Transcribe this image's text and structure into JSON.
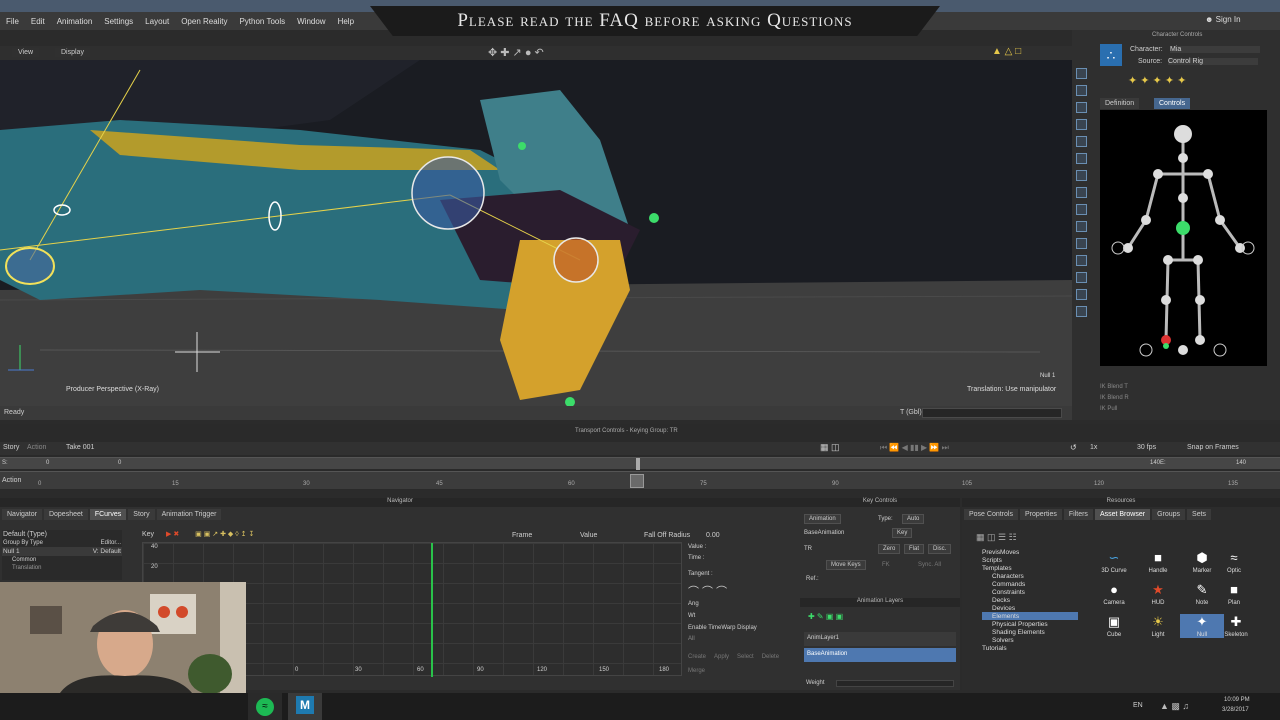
{
  "menu": [
    "File",
    "Edit",
    "Animation",
    "Settings",
    "Layout",
    "Open Reality",
    "Python Tools",
    "Window",
    "Help"
  ],
  "banner_text": "Please read the FAQ before asking Questions",
  "sign_in": "Sign In",
  "viewport": {
    "tabs": [
      "View",
      "Display"
    ],
    "camera_label": "Producer Perspective (X-Ray)",
    "object_label": "Null 1",
    "hint": "Translation: Use manipulator",
    "status": "Ready",
    "gbl": "T (Gbl)"
  },
  "char_controls": {
    "title": "Character Controls",
    "character_label": "Character:",
    "character_value": "Mia",
    "source_label": "Source:",
    "source_value": "Control Rig",
    "tabs": [
      "Definition",
      "Controls"
    ],
    "ik_labels": [
      "IK Blend T",
      "IK Blend R",
      "IK Pull"
    ]
  },
  "transport": {
    "title": "Transport Controls - Keying Group: TR",
    "story": "Story",
    "action": "Action",
    "take": "Take 001",
    "fps": "30 fps",
    "speed": "1x",
    "snap": "Snap on Frames",
    "start": "0",
    "start2": "0",
    "end": "140",
    "end2": "140",
    "ruler": [
      "0",
      "15",
      "30",
      "45",
      "60",
      "75",
      "90",
      "105",
      "120",
      "135"
    ],
    "row_s": "S:",
    "row_e": "E:"
  },
  "navigator": {
    "title": "Navigator",
    "tabs": [
      "Navigator",
      "Dopesheet",
      "FCurves",
      "Story",
      "Animation Trigger"
    ],
    "group_label": "Default (Type)",
    "group_by": "Group By Type",
    "editor": "Editor...",
    "node": "Null 1",
    "node_vis": "V: Default",
    "common": "Common",
    "translation": "Translation",
    "key_label": "Key",
    "frame_label": "Frame",
    "value_label": "Value",
    "falloff_label": "Fall Off Radius",
    "falloff_value": "0.00",
    "y_ticks": [
      "40",
      "20",
      "0"
    ],
    "x_ticks": [
      "0",
      "30",
      "60",
      "90",
      "120",
      "150",
      "180"
    ],
    "value_field": "Value :",
    "time_field": "Time :",
    "tangent": "Tangent :",
    "ang": "Ang",
    "wt": "Wt",
    "timewarp": "Enable TimeWarp Display",
    "all": "All",
    "buttons": [
      "Create",
      "Apply",
      "Select",
      "Delete",
      "Merge"
    ]
  },
  "key_controls": {
    "title": "Key Controls",
    "animation": "Animation",
    "type_label": "Type:",
    "type_value": "Auto",
    "layer": "BaseAnimation",
    "key": "Key",
    "tr": "TR",
    "zero": "Zero",
    "flat": "Flat",
    "disc": "Disc.",
    "move_keys": "Move Keys",
    "fk": "FK",
    "sync": "Sync. All",
    "ref": "Ref.:",
    "layers_title": "Animation Layers",
    "layers": [
      "AnimLayer1",
      "BaseAnimation"
    ],
    "weight": "Weight"
  },
  "resources": {
    "title": "Resources",
    "tabs": [
      "Pose Controls",
      "Properties",
      "Filters",
      "Asset Browser",
      "Groups",
      "Sets"
    ],
    "tree": [
      "PrevisMoves",
      "Scripts",
      "Templates",
      "Characters",
      "Commands",
      "Constraints",
      "Decks",
      "Devices",
      "Elements",
      "Physical Properties",
      "Shading Elements",
      "Solvers",
      "Tutorials"
    ],
    "assets": [
      "3D Curve",
      "Handle",
      "Marker",
      "Optic",
      "Camera",
      "HUD",
      "Note",
      "Plan",
      "Cube",
      "Light",
      "Null",
      "Skeleton"
    ]
  },
  "taskbar": {
    "lang": "EN",
    "time": "10:09 PM",
    "date": "3/28/2017"
  },
  "colors": {
    "accent": "#4e78b0",
    "selection_yellow": "#e8d24a",
    "effector_green": "#3cdc6a"
  }
}
